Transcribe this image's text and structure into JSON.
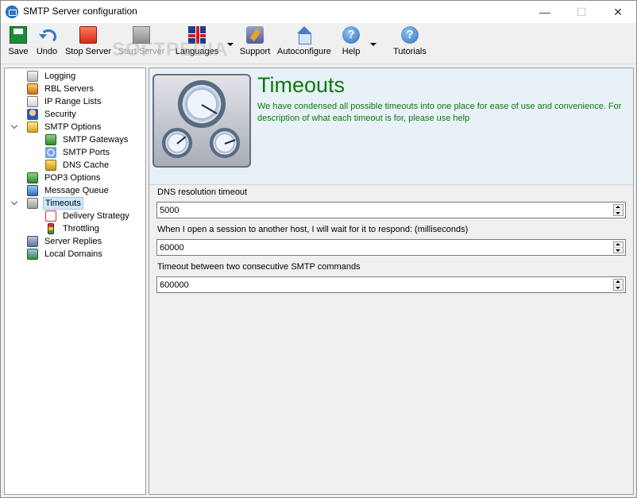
{
  "window": {
    "title": "SMTP Server configuration",
    "controls": {
      "minimize": "—",
      "maximize": "☐",
      "close": "✕"
    }
  },
  "toolbar": {
    "save": "Save",
    "undo": "Undo",
    "stop_server": "Stop Server",
    "start_server": "Start Server",
    "languages": "Languages",
    "support": "Support",
    "autoconfigure": "Autoconfigure",
    "help": "Help",
    "help_glyph": "?",
    "tutorials": "Tutorials"
  },
  "watermark": "SOFTPEDIA",
  "tree": {
    "items": [
      {
        "label": "Logging",
        "icon": "log-icon"
      },
      {
        "label": "RBL Servers",
        "icon": "rbl-icon"
      },
      {
        "label": "IP Range Lists",
        "icon": "ip-range-icon"
      },
      {
        "label": "Security",
        "icon": "security-icon"
      },
      {
        "label": "SMTP Options",
        "icon": "smtp-options-icon",
        "expanded": true
      },
      {
        "label": "SMTP Gateways",
        "icon": "gateway-icon"
      },
      {
        "label": "SMTP Ports",
        "icon": "ports-icon"
      },
      {
        "label": "DNS Cache",
        "icon": "dns-cache-icon"
      },
      {
        "label": "POP3 Options",
        "icon": "pop3-icon"
      },
      {
        "label": "Message Queue",
        "icon": "queue-icon"
      },
      {
        "label": "Timeouts",
        "icon": "timeouts-icon",
        "expanded": true,
        "selected": true
      },
      {
        "label": "Delivery Strategy",
        "icon": "calendar-icon"
      },
      {
        "label": "Throttling",
        "icon": "traffic-light-icon"
      },
      {
        "label": "Server Replies",
        "icon": "server-replies-icon"
      },
      {
        "label": "Local Domains",
        "icon": "local-domains-icon"
      }
    ]
  },
  "panel": {
    "title": "Timeouts",
    "description": "We have condensed all possible timeouts into one place for ease of use and convenience. For description of what each  timeout is for, please use help",
    "fields": [
      {
        "label": "DNS resolution timeout",
        "value": "5000"
      },
      {
        "label": "When I open a session to another host, I will wait for it to respond: (milliseconds)",
        "value": "60000"
      },
      {
        "label": "Timeout between two consecutive SMTP commands",
        "value": "600000"
      }
    ]
  },
  "colors": {
    "accent_green": "#0b7a0b",
    "header_bg": "#e8f0f8",
    "selection": "#cce8ff"
  }
}
